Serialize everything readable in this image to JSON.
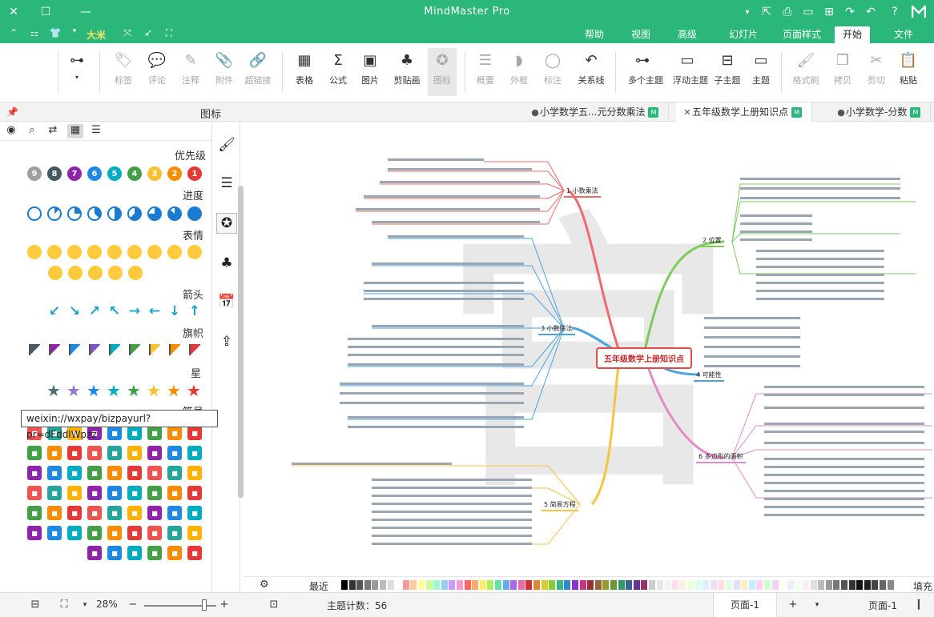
{
  "app": {
    "title": "MindMaster Pro"
  },
  "titlebar": {
    "icons": [
      "logo-icon",
      "help-icon",
      "undo-icon",
      "redo-icon",
      "new-icon",
      "open-icon",
      "save-icon",
      "print-icon",
      "export-icon",
      "dropdown-icon",
      "minimize-icon",
      "maximize-icon",
      "close-icon"
    ]
  },
  "menubar": {
    "items": [
      {
        "label": "文件"
      },
      {
        "label": "开始",
        "active": true
      },
      {
        "label": "页面样式"
      },
      {
        "label": "幻灯片"
      },
      {
        "label": "高级"
      },
      {
        "label": "视图"
      },
      {
        "label": "帮助"
      }
    ],
    "user": "大米"
  },
  "ribbon": {
    "buttons": [
      {
        "label": "粘贴",
        "icon": "paste-icon",
        "disabled": false
      },
      {
        "label": "剪切",
        "icon": "cut-icon",
        "disabled": true
      },
      {
        "label": "拷贝",
        "icon": "copy-icon",
        "disabled": true
      },
      {
        "label": "格式刷",
        "icon": "format-painter-icon",
        "disabled": true
      },
      {
        "label": "主题",
        "icon": "topic-icon",
        "disabled": false
      },
      {
        "label": "子主题",
        "icon": "subtopic-icon",
        "disabled": false
      },
      {
        "label": "浮动主题",
        "icon": "floating-topic-icon",
        "disabled": false
      },
      {
        "label": "多个主题",
        "icon": "multiple-topics-icon",
        "disabled": false
      },
      {
        "label": "关系线",
        "icon": "relationship-icon",
        "disabled": false
      },
      {
        "label": "标注",
        "icon": "callout-icon",
        "disabled": true
      },
      {
        "label": "外框",
        "icon": "boundary-icon",
        "disabled": true
      },
      {
        "label": "概要",
        "icon": "summary-icon",
        "disabled": true
      },
      {
        "label": "图标",
        "icon": "mark-icon",
        "disabled": true
      },
      {
        "label": "剪贴画",
        "icon": "clipart-icon",
        "disabled": false
      },
      {
        "label": "图片",
        "icon": "picture-icon",
        "disabled": false
      },
      {
        "label": "公式",
        "icon": "formula-icon",
        "disabled": false
      },
      {
        "label": "表格",
        "icon": "table-icon",
        "disabled": false
      },
      {
        "label": "超链接",
        "icon": "hyperlink-icon",
        "disabled": true
      },
      {
        "label": "附件",
        "icon": "attachment-icon",
        "disabled": true
      },
      {
        "label": "注释",
        "icon": "note-icon",
        "disabled": true
      },
      {
        "label": "评论",
        "icon": "comment-icon",
        "disabled": true
      },
      {
        "label": "标签",
        "icon": "tag-icon",
        "disabled": true
      },
      {
        "label": "",
        "icon": "layout-icon",
        "disabled": false
      }
    ]
  },
  "doctabs": {
    "tabs": [
      {
        "label": "小学数学-分数",
        "active": false
      },
      {
        "label": "五年级数学上册知识点",
        "active": true
      },
      {
        "label": "小学数学五...元分数乘法",
        "active": false
      }
    ],
    "panel_title": "图标"
  },
  "leftpanel": {
    "sections": {
      "priority": "优先级",
      "progress": "进度",
      "face": "表情",
      "arrow": "箭头",
      "flag": "旗帜",
      "star": "星",
      "clipart": "符号"
    },
    "priority_numbers": [
      "1",
      "2",
      "3",
      "4",
      "5",
      "6",
      "7",
      "8",
      "9"
    ],
    "priority_colors": [
      "#e53935",
      "#fb8c00",
      "#fbc02d",
      "#43a047",
      "#00acc1",
      "#1e88e5",
      "#8e24aa",
      "#455a64",
      "#9e9e9e"
    ],
    "progress_values": [
      1,
      0.875,
      0.75,
      0.625,
      0.5,
      0.375,
      0.25,
      0.125,
      0
    ],
    "arrows": [
      "↑",
      "↓",
      "←",
      "→",
      "↖",
      "↗",
      "↘",
      "↙"
    ],
    "flag_colors": [
      "#e53935",
      "#fb8c00",
      "#fbc02d",
      "#43a047",
      "#00acc1",
      "#7e57c2",
      "#1e88e5",
      "#8e24aa",
      "#455a64"
    ],
    "star_colors": [
      "#e53935",
      "#fb8c00",
      "#fbc02d",
      "#43a047",
      "#00acc1",
      "#1e88e5",
      "#9575cd",
      "#546e7a"
    ],
    "tooltip": "weixin://wxpay/bizpayurl?pr=dFddlWpzz"
  },
  "canvas": {
    "root": "五年级数学上册知识点",
    "topics": [
      "1 小数乘法",
      "2 位置",
      "3 小数除法",
      "4 可能性",
      "5 简易方程",
      "6 多边形的面积"
    ]
  },
  "palette": {
    "label": "填充",
    "right_label": "最近"
  },
  "statusbar": {
    "page_tab": "页面-1",
    "page_label": "页面-1",
    "topic_count": "主题计数：56",
    "zoom": "28%"
  }
}
